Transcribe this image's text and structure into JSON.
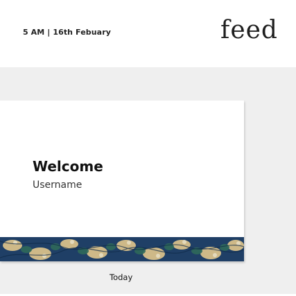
{
  "header": {
    "datetime": "5 AM | 16th Febuary",
    "brand": "feed"
  },
  "card": {
    "title": "Welcome",
    "subtitle": "Username"
  },
  "section": {
    "label": "Today"
  }
}
